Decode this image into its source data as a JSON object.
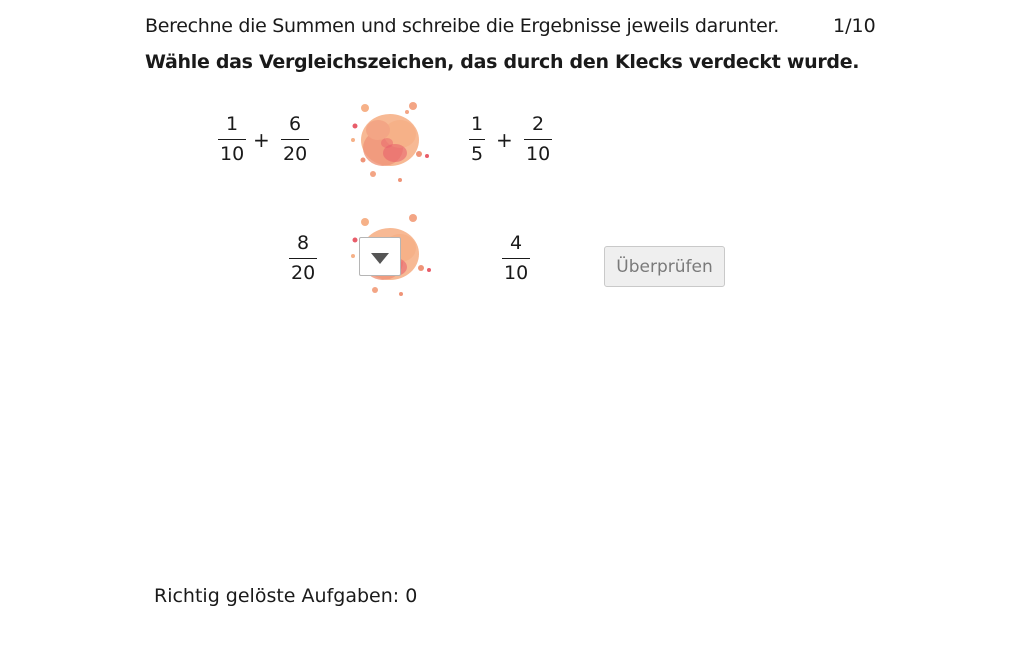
{
  "instruction": "Berechne die Summen und schreibe die Ergebnisse jeweils darunter.",
  "counter": "1/10",
  "task": "Wähle das Vergleichszeichen, das durch den Klecks verdeckt wurde.",
  "row1": {
    "left": {
      "a": {
        "num": "1",
        "den": "10"
      },
      "op": "+",
      "b": {
        "num": "6",
        "den": "20"
      }
    },
    "right": {
      "a": {
        "num": "1",
        "den": "5"
      },
      "op": "+",
      "b": {
        "num": "2",
        "den": "10"
      }
    }
  },
  "row2": {
    "left": {
      "num": "8",
      "den": "20"
    },
    "right": {
      "num": "4",
      "den": "10"
    },
    "select_value": ""
  },
  "check_button": "Überprüfen",
  "score": {
    "label": "Richtig gelöste Aufgaben:",
    "value": "0"
  },
  "colors": {
    "blot_light": "#f6b188",
    "blot_mid": "#ef9478",
    "blot_dark": "#e85d6a",
    "button_bg": "#efefef",
    "button_text": "#7a7a7a"
  },
  "icons": {
    "blot": "paint-splatter-icon",
    "dropdown": "caret-down-icon"
  }
}
